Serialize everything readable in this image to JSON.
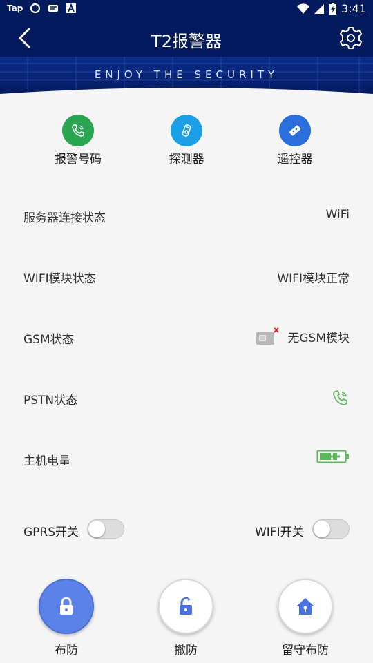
{
  "status_bar": {
    "app_label": "Tap",
    "time": "3:41"
  },
  "header": {
    "title": "T2报警器"
  },
  "banner": {
    "slogan": "ENJOY THE SECURITY"
  },
  "shortcuts": [
    {
      "label": "报警号码",
      "icon": "phone-icon",
      "color": "#2aa653"
    },
    {
      "label": "探测器",
      "icon": "detector-icon",
      "color": "#1b9fe6"
    },
    {
      "label": "遥控器",
      "icon": "remote-icon",
      "color": "#2a6fdb"
    }
  ],
  "status_rows": {
    "server": {
      "label": "服务器连接状态",
      "value": "WiFi"
    },
    "wifi_module": {
      "label": "WIFI模块状态",
      "value": "WIFI模块正常"
    },
    "gsm": {
      "label": "GSM状态",
      "value": "无GSM模块"
    },
    "pstn": {
      "label": "PSTN状态"
    },
    "battery": {
      "label": "主机电量"
    }
  },
  "toggles": {
    "gprs": {
      "label": "GPRS开关",
      "on": false
    },
    "wifi": {
      "label": "WIFI开关",
      "on": false
    }
  },
  "arm_buttons": [
    {
      "label": "布防",
      "active": true
    },
    {
      "label": "撤防",
      "active": false
    },
    {
      "label": "留守布防",
      "active": false
    }
  ],
  "colors": {
    "header_bg": "#031a5c",
    "accent_blue": "#5b82e8",
    "green": "#5cb85c"
  }
}
